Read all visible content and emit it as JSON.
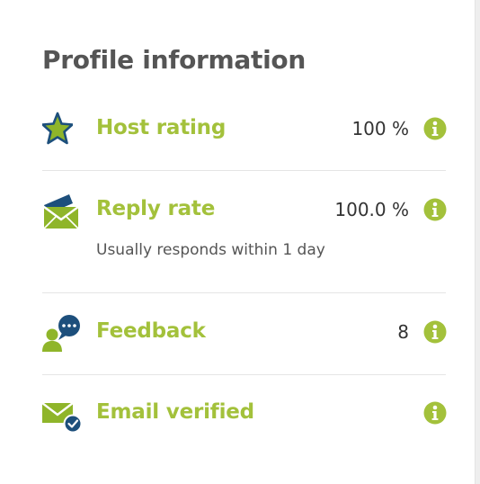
{
  "profile": {
    "title": "Profile information",
    "items": [
      {
        "icon": "star-icon",
        "label": "Host rating",
        "value": "100 %"
      },
      {
        "icon": "envelope-icon",
        "label": "Reply rate",
        "value": "100.0 %",
        "subtext": "Usually responds within 1 day"
      },
      {
        "icon": "chat-user-icon",
        "label": "Feedback",
        "value": "8"
      },
      {
        "icon": "verified-envelope-icon",
        "label": "Email verified",
        "value": ""
      }
    ]
  },
  "colors": {
    "accent": "#a3c13b",
    "icon_navy": "#1d4f7c",
    "text": "#333333",
    "title": "#555555"
  }
}
